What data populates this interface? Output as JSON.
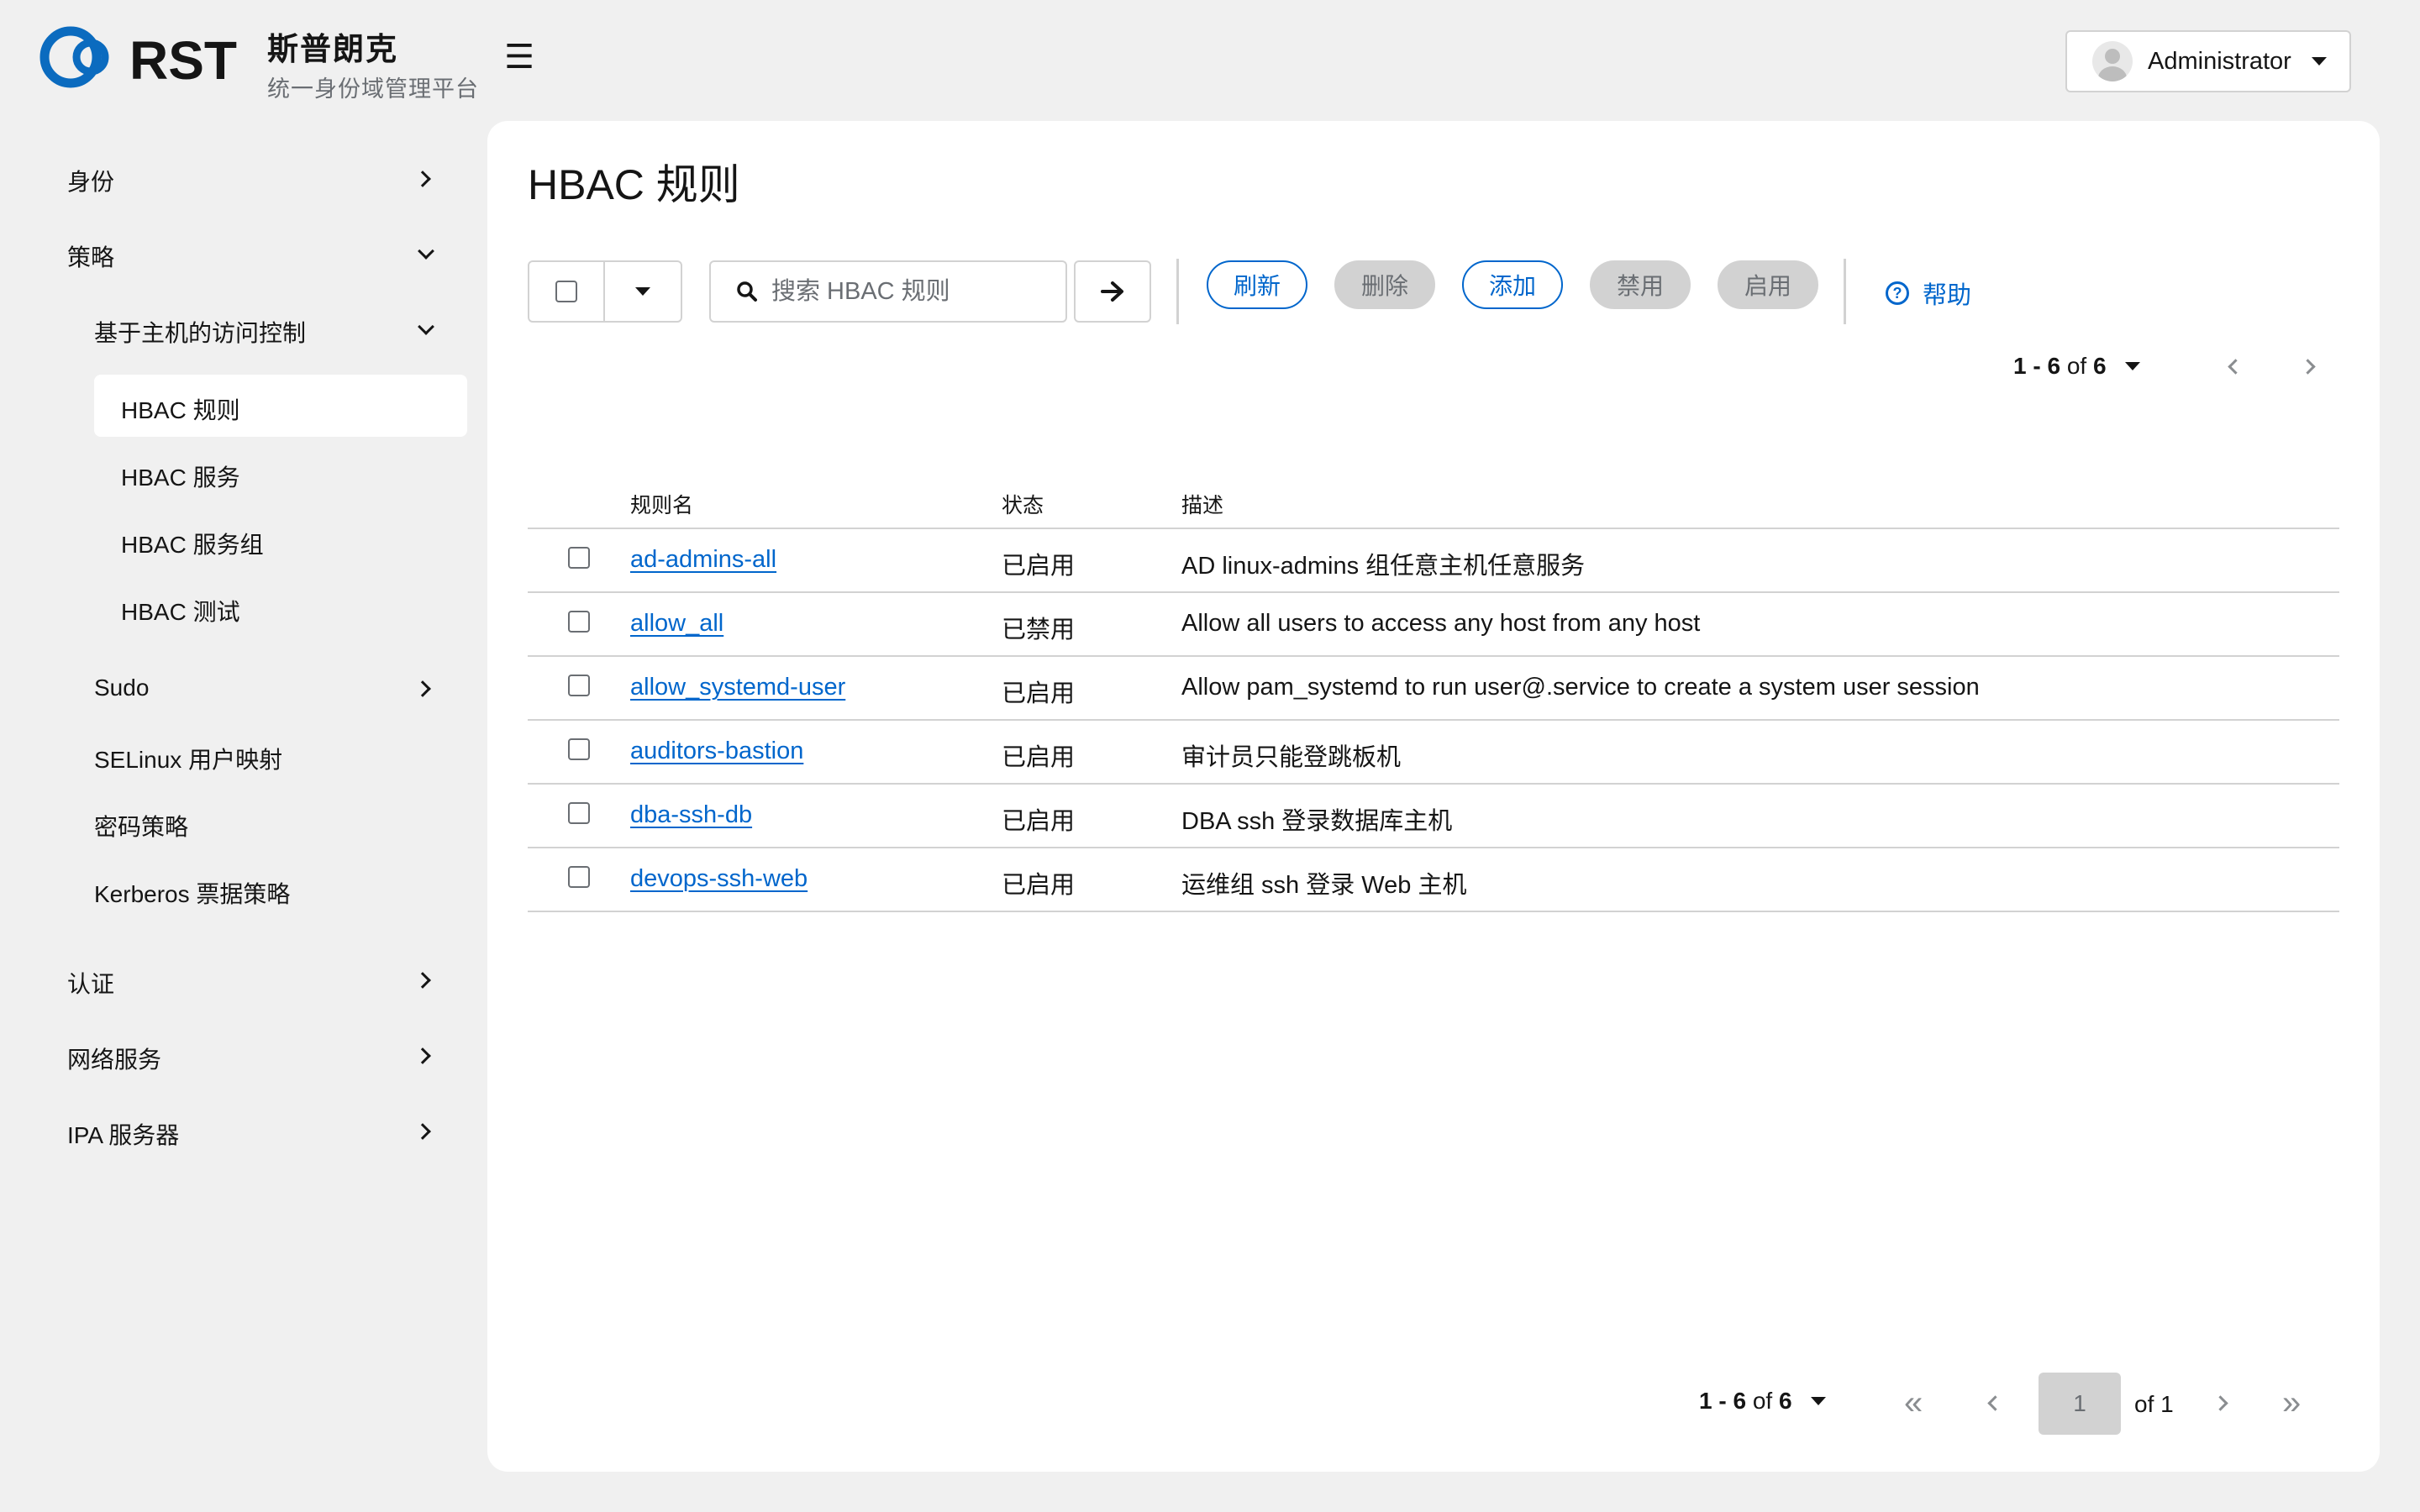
{
  "brand": {
    "logo_text": "RST",
    "name": "斯普朗克",
    "subtitle": "统一身份域管理平台"
  },
  "header": {
    "menu_icon": "hamburger-icon",
    "user_name": "Administrator"
  },
  "sidebar": {
    "items": [
      {
        "label": "身份",
        "icon": "chevron-right-icon"
      },
      {
        "label": "策略",
        "icon": "chevron-down-icon"
      },
      {
        "label": "基于主机的访问控制",
        "icon": "chevron-down-icon"
      },
      {
        "label": "HBAC 规则",
        "active": true
      },
      {
        "label": "HBAC 服务"
      },
      {
        "label": "HBAC 服务组"
      },
      {
        "label": "HBAC 测试"
      },
      {
        "label": "Sudo",
        "icon": "chevron-right-icon"
      },
      {
        "label": "SELinux 用户映射"
      },
      {
        "label": "密码策略"
      },
      {
        "label": "Kerberos 票据策略"
      },
      {
        "label": "认证",
        "icon": "chevron-right-icon"
      },
      {
        "label": "网络服务",
        "icon": "chevron-right-icon"
      },
      {
        "label": "IPA 服务器",
        "icon": "chevron-right-icon"
      }
    ]
  },
  "main": {
    "title": "HBAC 规则",
    "search_placeholder": "搜索 HBAC 规则",
    "actions": {
      "refresh": "刷新",
      "delete": "删除",
      "add": "添加",
      "disable": "禁用",
      "enable": "启用"
    },
    "help": "帮助",
    "pagination": {
      "range_start": "1",
      "range_sep": " - ",
      "range_end": "6",
      "of_word": " of ",
      "total": "6",
      "current_page": "1",
      "of_pages": "of 1"
    },
    "table": {
      "columns": [
        "规则名",
        "状态",
        "描述"
      ],
      "rows": [
        {
          "name": "ad-admins-all",
          "status": "已启用",
          "description": "AD linux-admins 组任意主机任意服务"
        },
        {
          "name": "allow_all",
          "status": "已禁用",
          "description": "Allow all users to access any host from any host"
        },
        {
          "name": "allow_systemd-user",
          "status": "已启用",
          "description": "Allow pam_systemd to run user@.service to create a system user session"
        },
        {
          "name": "auditors-bastion",
          "status": "已启用",
          "description": "审计员只能登跳板机"
        },
        {
          "name": "dba-ssh-db",
          "status": "已启用",
          "description": "DBA ssh 登录数据库主机"
        },
        {
          "name": "devops-ssh-web",
          "status": "已启用",
          "description": "运维组 ssh 登录 Web 主机"
        }
      ]
    }
  },
  "colors": {
    "accent": "#0066cc",
    "page_bg": "#f0f0f0",
    "disabled_bg": "#d2d2d2"
  }
}
